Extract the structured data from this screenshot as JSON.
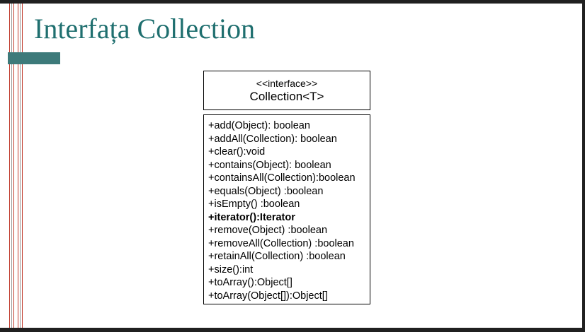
{
  "title": "Interfața Collection",
  "uml": {
    "stereotype": "<<interface>>",
    "class_name": "Collection<T>",
    "methods": [
      "+add(Object): boolean",
      "+addAll(Collection): boolean",
      "+clear():void",
      "+contains(Object): boolean",
      "+containsAll(Collection):boolean",
      "+equals(Object) :boolean",
      "+isEmpty() :boolean",
      "+iterator():Iterator",
      "+remove(Object) :boolean",
      "+removeAll(Collection) :boolean",
      "+retainAll(Collection) :boolean",
      "+size():int",
      "+toArray():Object[]",
      "+toArray(Object[]):Object[]"
    ]
  },
  "colors": {
    "title": "#1f6f6f",
    "accent_bar": "#3d7a7a",
    "rules": "#c0392b"
  }
}
